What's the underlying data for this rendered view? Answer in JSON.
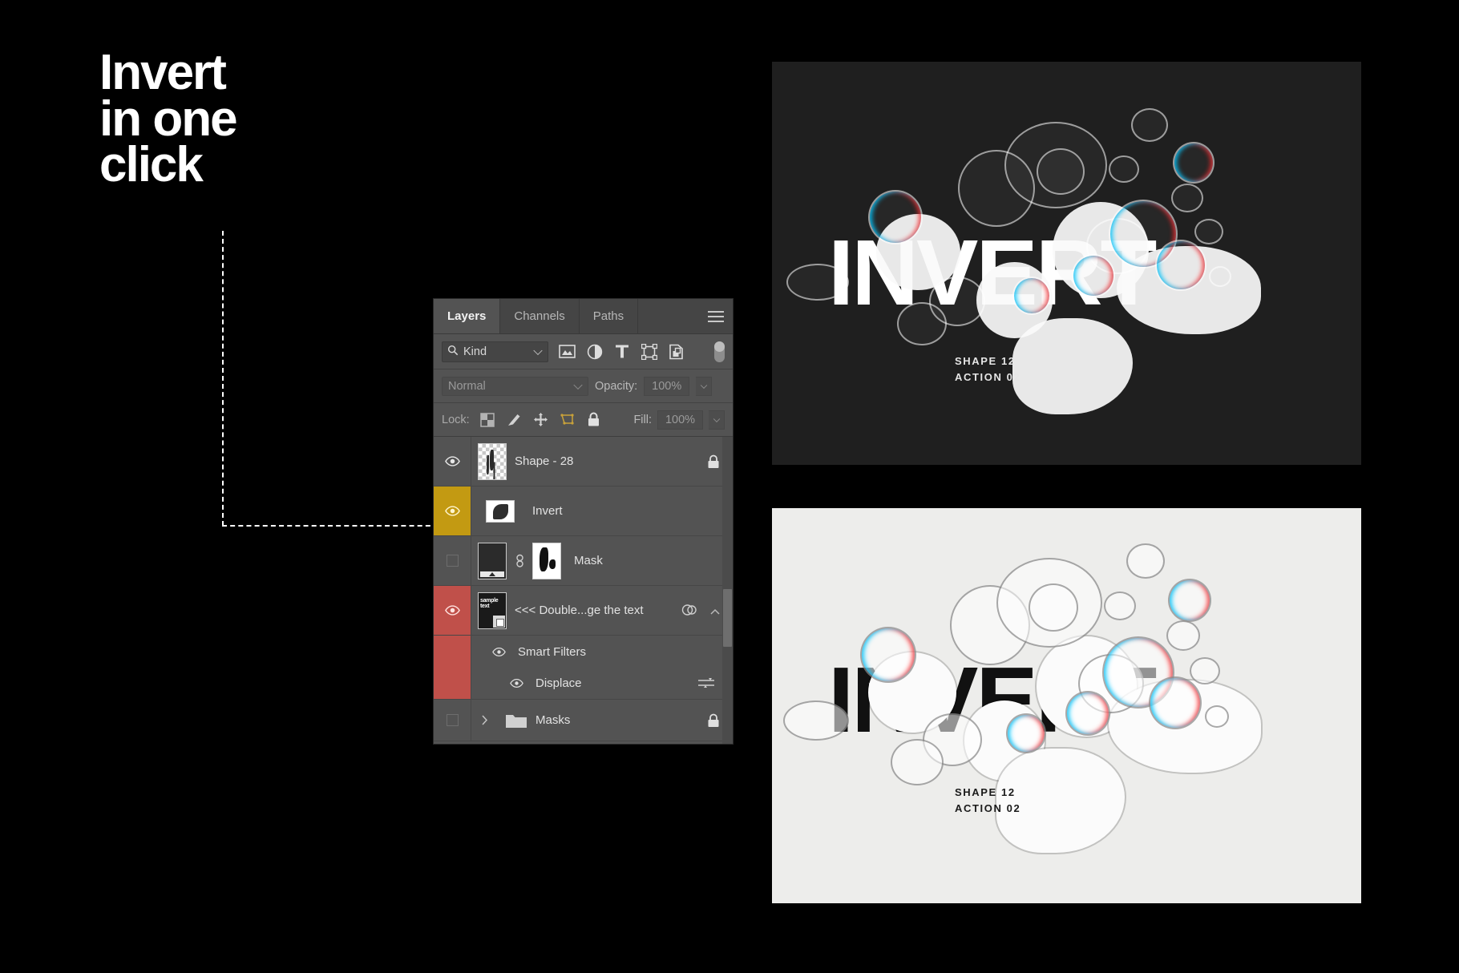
{
  "headline": {
    "line1": "Invert",
    "line2": "in one",
    "line3": "click"
  },
  "panel": {
    "tabs": [
      {
        "label": "Layers",
        "active": true
      },
      {
        "label": "Channels",
        "active": false
      },
      {
        "label": "Paths",
        "active": false
      }
    ],
    "menu_icon": "hamburger-menu-icon",
    "filter": {
      "search_icon": "search-icon",
      "kind_label": "Kind",
      "dropdown_icon": "chevron-down-icon",
      "icons": [
        "pixel-layer-filter-icon",
        "adjustment-layer-filter-icon",
        "type-layer-filter-icon",
        "shape-layer-filter-icon",
        "smart-object-filter-icon"
      ],
      "toggle_icon": "filter-toggle-switch"
    },
    "blend": {
      "mode": "Normal",
      "opacity_label": "Opacity:",
      "opacity_value": "100%"
    },
    "lock": {
      "label": "Lock:",
      "icons": [
        "lock-transparent-pixels-icon",
        "lock-image-pixels-icon",
        "lock-position-icon",
        "lock-artboard-nesting-icon",
        "lock-all-icon"
      ],
      "fill_label": "Fill:",
      "fill_value": "100%"
    },
    "layers": [
      {
        "name": "Shape - 28",
        "visible": true,
        "highlight": "none",
        "thumb": "checker-shape-thumbnail",
        "lock_icon": "lock-icon"
      },
      {
        "name": "Invert",
        "visible": true,
        "highlight": "yellow",
        "thumb": "invert-adjustment-thumbnail"
      },
      {
        "name": "Mask",
        "visible": false,
        "highlight": "none",
        "thumb": "gradient-layer-thumbnail",
        "link_icon": "link-icon",
        "mask_thumb": "layer-mask-thumbnail"
      },
      {
        "name": "<<< Double...ge the text",
        "visible": true,
        "highlight": "red",
        "thumb": "smart-object-thumbnail",
        "fx_icon": "smart-filter-icon",
        "caret_icon": "chevron-up-icon"
      }
    ],
    "smart_filters": {
      "label": "Smart Filters",
      "visible": true,
      "children": [
        {
          "label": "Displace",
          "visible": true,
          "options_icon": "filter-options-icon"
        }
      ]
    },
    "group": {
      "name": "Masks",
      "visible": false,
      "expand_icon": "chevron-right-icon",
      "folder_icon": "folder-icon",
      "lock_icon": "lock-icon"
    }
  },
  "artwork": {
    "dark": {
      "word": "INVERT",
      "caption_line1": "SHAPE 12",
      "caption_line2": "ACTION 02",
      "background": "#1f1f1f"
    },
    "light": {
      "word": "INVERT",
      "caption_line1": "SHAPE 12",
      "caption_line2": "ACTION 02",
      "background": "#ededeb"
    }
  },
  "colors": {
    "page_background": "#000000",
    "panel_background": "#535353",
    "highlight_yellow": "#c39a12",
    "highlight_red": "#c0504a",
    "callout_line": "#ffffff"
  }
}
